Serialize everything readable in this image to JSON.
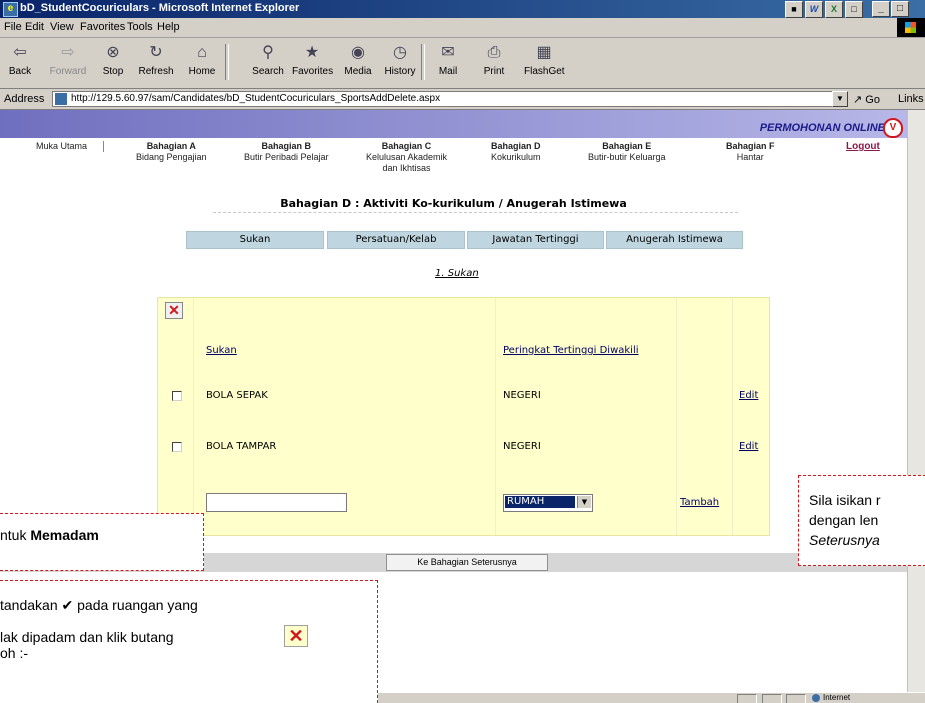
{
  "window": {
    "title": "bD_StudentCocuriculars - Microsoft Internet Explorer",
    "window_buttons": [
      "_",
      "□",
      "×"
    ]
  },
  "menubar": [
    "File",
    "Edit",
    "View",
    "Favorites",
    "Tools",
    "Help"
  ],
  "toolbar": {
    "back": "Back",
    "forward": "Forward",
    "stop": "Stop",
    "refresh": "Refresh",
    "home": "Home",
    "search": "Search",
    "favorites": "Favorites",
    "media": "Media",
    "history": "History",
    "mail": "Mail",
    "print": "Print",
    "flashget": "FlashGet"
  },
  "address": {
    "label": "Address",
    "url": "http://129.5.60.97/sam/Candidates/bD_StudentCocuriculars_SportsAddDelete.aspx",
    "go": "Go",
    "links": "Links"
  },
  "brand": {
    "text": "PERMOHONAN ONLINE"
  },
  "nav": {
    "home": "Muka Utama",
    "items": [
      {
        "title": "Bahagian A",
        "sub": "Bidang Pengajian"
      },
      {
        "title": "Bahagian B",
        "sub": "Butir Peribadi Pelajar"
      },
      {
        "title": "Bahagian C",
        "sub": "Kelulusan Akademik",
        "sub2": "dan Ikhtisas"
      },
      {
        "title": "Bahagian D",
        "sub": "Kokurikulum"
      },
      {
        "title": "Bahagian E",
        "sub": "Butir-butir Keluarga"
      },
      {
        "title": "Bahagian F",
        "sub": "Hantar"
      }
    ],
    "logout": "Logout"
  },
  "section_title": "Bahagian D : Aktiviti Ko-kurikulum / Anugerah Istimewa",
  "tabs": [
    "Sukan",
    "Persatuan/Kelab",
    "Jawatan Tertinggi",
    "Anugerah Istimewa"
  ],
  "sub_link": "1. Sukan",
  "table": {
    "headers": {
      "sport": "Sukan",
      "level": "Peringkat Tertinggi Diwakili"
    },
    "rows": [
      {
        "sport": "BOLA SEPAK",
        "level": "NEGERI",
        "action": "Edit"
      },
      {
        "sport": "BOLA TAMPAR",
        "level": "NEGERI",
        "action": "Edit"
      }
    ],
    "new_row": {
      "select_value": "RUMAH",
      "add_link": "Tambah"
    }
  },
  "next_button": "Ke Bahagian Seterusnya",
  "status": {
    "zone": "Internet"
  },
  "callouts": {
    "right": [
      "Sila isikan r",
      "dengan len",
      "Seterusnya"
    ],
    "left": {
      "prefix": "ntuk ",
      "bold": "Memadam"
    },
    "bottom": [
      "tandakan ✔ pada ruangan yang",
      "lak dipadam dan klik butang",
      "oh :-"
    ]
  }
}
